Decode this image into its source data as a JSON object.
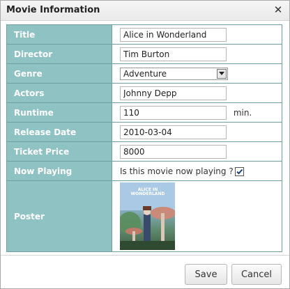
{
  "dialog": {
    "title": "Movie Information",
    "close_glyph": "✕"
  },
  "fields": {
    "title": {
      "label": "Title",
      "value": "Alice in Wonderland"
    },
    "director": {
      "label": "Director",
      "value": "Tim Burton"
    },
    "genre": {
      "label": "Genre",
      "value": "Adventure"
    },
    "actors": {
      "label": "Actors",
      "value": "Johnny Depp"
    },
    "runtime": {
      "label": "Runtime",
      "value": "110",
      "unit": "min."
    },
    "release_date": {
      "label": "Release Date",
      "value": "2010-03-04"
    },
    "ticket_price": {
      "label": "Ticket Price",
      "value": "8000"
    },
    "now_playing": {
      "label": "Now Playing",
      "question": "Is this movie now playing ?",
      "checked": true
    },
    "poster": {
      "label": "Poster",
      "poster_title": "ALICE IN WONDERLAND"
    }
  },
  "buttons": {
    "save": "Save",
    "cancel": "Cancel"
  },
  "colors": {
    "label_bg": "#8fc2c3",
    "border": "#6e9ea0"
  }
}
